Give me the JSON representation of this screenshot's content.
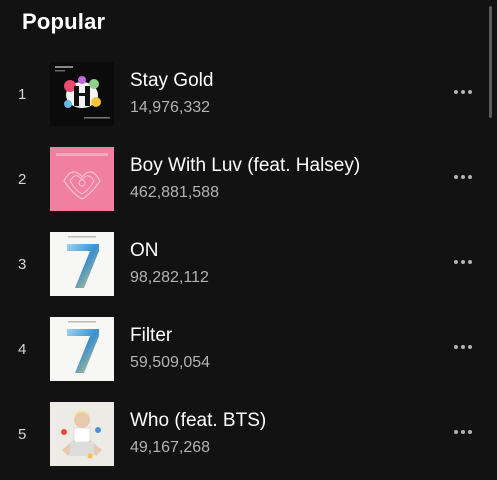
{
  "section": {
    "title": "Popular"
  },
  "tracks": [
    {
      "number": "1",
      "title": "Stay Gold",
      "plays": "14,976,332",
      "cover_icon": "map-of-the-soul-7-journey-cover"
    },
    {
      "number": "2",
      "title": "Boy With Luv (feat. Halsey)",
      "plays": "462,881,588",
      "cover_icon": "map-of-the-soul-persona-cover"
    },
    {
      "number": "3",
      "title": "ON",
      "plays": "98,282,112",
      "cover_icon": "map-of-the-soul-7-cover"
    },
    {
      "number": "4",
      "title": "Filter",
      "plays": "59,509,054",
      "cover_icon": "map-of-the-soul-7-cover"
    },
    {
      "number": "5",
      "title": "Who (feat. BTS)",
      "plays": "49,167,268",
      "cover_icon": "who-single-cover"
    }
  ],
  "more_icon": "more-options-icon",
  "colors": {
    "background": "#121212",
    "title_text": "#ffffff",
    "secondary_text": "#b3b3b3",
    "persona_pink": "#f07fa0"
  }
}
